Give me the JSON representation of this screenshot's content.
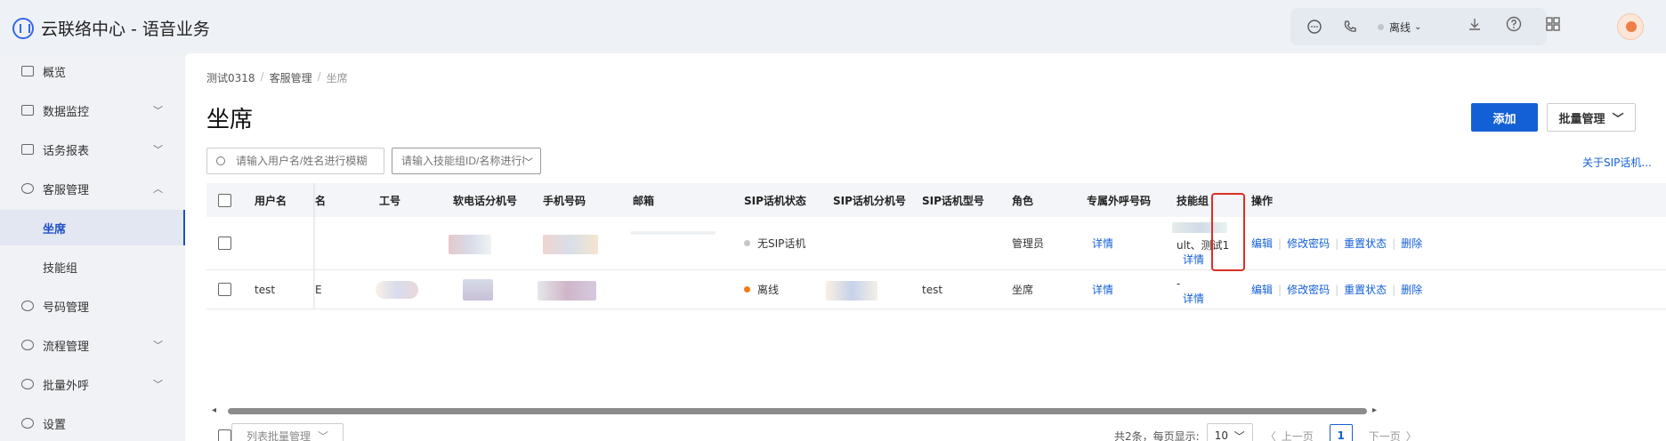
{
  "app": {
    "title": "云联络中心 - 语音业务",
    "logo_icon": "headset-logo-icon"
  },
  "header": {
    "status_label": "离线",
    "icons": [
      "chat-icon",
      "phone-icon",
      "download-icon",
      "help-icon",
      "grid-icon"
    ]
  },
  "sidebar": {
    "items": [
      {
        "label": "概览",
        "icon": "overview-icon"
      },
      {
        "label": "数据监控",
        "icon": "monitor-icon"
      },
      {
        "label": "话务报表",
        "icon": "report-icon"
      },
      {
        "label": "客服管理",
        "icon": "headset-icon"
      },
      {
        "label": "坐席",
        "sub": true,
        "active": true
      },
      {
        "label": "技能组",
        "sub": true
      },
      {
        "label": "号码管理",
        "icon": "phone-icon"
      },
      {
        "label": "流程管理",
        "icon": "flow-icon"
      },
      {
        "label": "批量外呼",
        "icon": "outbound-icon"
      },
      {
        "label": "设置",
        "icon": "gear-icon"
      }
    ]
  },
  "breadcrumb": {
    "items": [
      "测试0318",
      "客服管理",
      "坐席"
    ]
  },
  "page": {
    "title": "坐席"
  },
  "toolbar": {
    "add_label": "添加",
    "batch_label": "批量管理"
  },
  "filters": {
    "user_placeholder": "请输入用户名/姓名进行模糊",
    "skill_placeholder": "请输入技能组ID/名称进行模糊"
  },
  "sip_link": "关于SIP话机...",
  "table": {
    "columns": [
      "用户名",
      "名",
      "工号",
      "软电话分机号",
      "手机号码",
      "邮箱",
      "SIP话机状态",
      "SIP话机分机号",
      "SIP话机型号",
      "角色",
      "专属外呼号码",
      "技能组",
      "操作"
    ],
    "rows": [
      {
        "username": "",
        "sip_status": "无SIP话机",
        "sip_status_color": "#c8c8c8",
        "sip_model": "",
        "role": "管理员",
        "outbound": "详情",
        "skill": "ult、测试1",
        "skill_detail": "详情",
        "ops": [
          "编辑",
          "修改密码",
          "重置状态",
          "删除"
        ]
      },
      {
        "username": "test",
        "name_partial": "E",
        "sip_status": "离线",
        "sip_status_color": "#f07c16",
        "sip_model": "test",
        "role": "坐席",
        "outbound": "详情",
        "skill": "-",
        "skill_detail": "详情",
        "ops": [
          "编辑",
          "修改密码",
          "重置状态",
          "删除"
        ]
      }
    ]
  },
  "footer": {
    "batch_label": "列表批量管理",
    "total_label": "共2条，每页显示:",
    "page_size": "10",
    "prev_label": "上一页",
    "current_page": "1",
    "next_label": "下一页"
  }
}
